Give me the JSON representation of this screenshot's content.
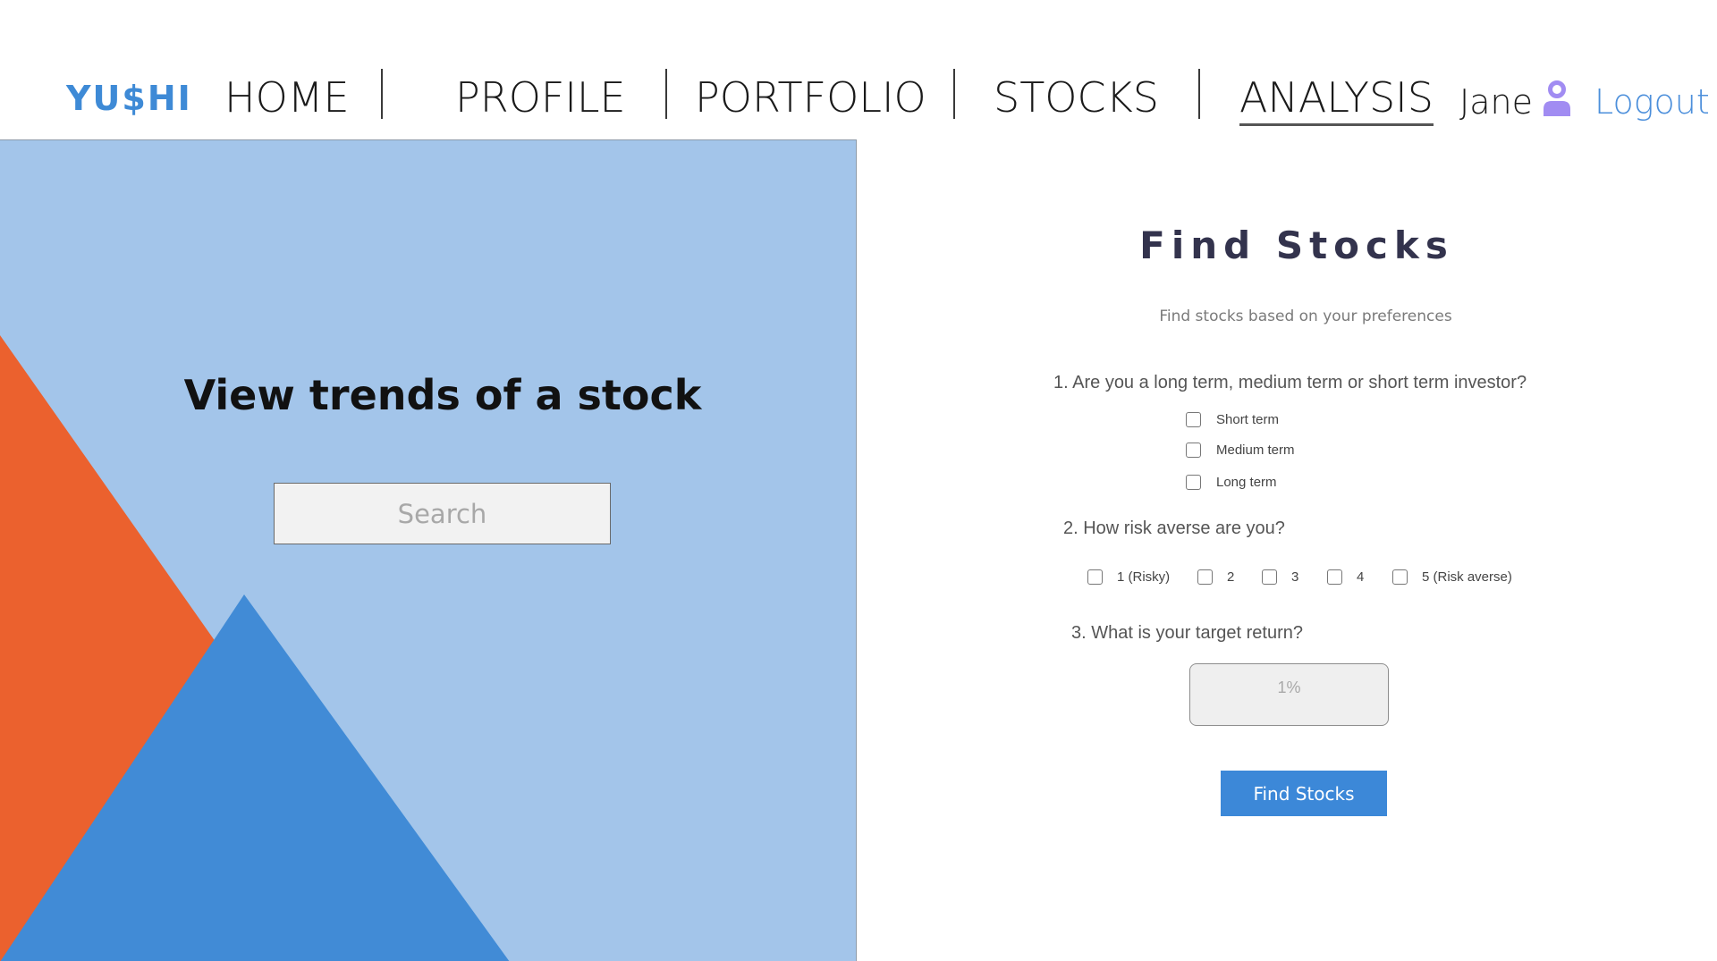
{
  "nav": {
    "logo": "YU$HI",
    "items": [
      {
        "label": "HOME",
        "active": false
      },
      {
        "label": "PROFILE",
        "active": false
      },
      {
        "label": "PORTFOLIO",
        "active": false
      },
      {
        "label": "STOCKS",
        "active": false
      },
      {
        "label": "ANALYSIS",
        "active": true
      }
    ],
    "user_name": "Jane",
    "user_icon": "user-icon",
    "logout_label": "Logout"
  },
  "hero": {
    "title": "View trends of a stock",
    "search_placeholder": "Search"
  },
  "find_stocks": {
    "title": "Find Stocks",
    "subtitle": "Find stocks based on your preferences",
    "q1": {
      "text": "1. Are you a long term, medium term or short term investor?",
      "options": [
        "Short term",
        "Medium term",
        "Long term"
      ]
    },
    "q2": {
      "text": "2. How risk averse are you?",
      "options": [
        "1 (Risky)",
        "2",
        "3",
        "4",
        "5 (Risk averse)"
      ]
    },
    "q3": {
      "text": "3. What is your target return?",
      "placeholder": "1%"
    },
    "button_label": "Find Stocks"
  },
  "colors": {
    "brand": "#3e8ad6",
    "hero_background": "#a3c5ea",
    "orange": "#eb612e",
    "blue": "#418bd6",
    "button": "#3c88d8"
  }
}
